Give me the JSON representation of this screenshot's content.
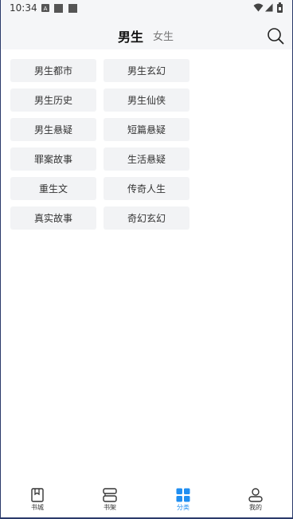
{
  "status_bar": {
    "time": "10:34"
  },
  "header": {
    "tabs": [
      {
        "label": "男生",
        "active": true
      },
      {
        "label": "女生",
        "active": false
      }
    ]
  },
  "categories": [
    "男生都市",
    "男生玄幻",
    "男生历史",
    "男生仙侠",
    "男生悬疑",
    "短篇悬疑",
    "罪案故事",
    "生活悬疑",
    "重生文",
    "传奇人生",
    "真实故事",
    "奇幻玄幻"
  ],
  "bottom_nav": [
    {
      "label": "书城",
      "icon": "bookstore-icon",
      "active": false
    },
    {
      "label": "书架",
      "icon": "bookshelf-icon",
      "active": false
    },
    {
      "label": "分类",
      "icon": "category-grid-icon",
      "active": true
    },
    {
      "label": "我的",
      "icon": "profile-icon",
      "active": false
    }
  ],
  "colors": {
    "accent": "#1f8ef1",
    "tile_bg": "#f2f3f5",
    "header_bg": "#f5f6f8"
  }
}
